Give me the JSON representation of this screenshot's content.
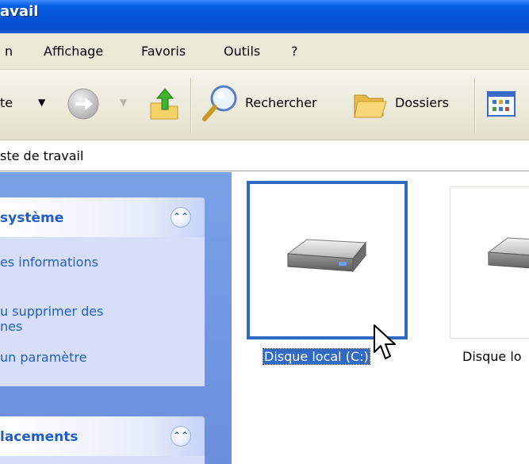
{
  "window": {
    "title": "avail"
  },
  "menu": {
    "items": [
      "n",
      "Affichage",
      "Favoris",
      "Outils",
      "?"
    ]
  },
  "toolbar": {
    "back_label": "te",
    "search_label": "Rechercher",
    "folders_label": "Dossiers"
  },
  "address": {
    "value": "ste de travail"
  },
  "sidebar": {
    "system_group": {
      "title": "système",
      "tasks": [
        "es informations",
        "u supprimer des",
        "nes",
        "un paramètre"
      ]
    },
    "places_group": {
      "title": "lacements"
    }
  },
  "drives": [
    {
      "label": "Disque local (C:)",
      "selected": true,
      "icon": "hard-drive-icon"
    },
    {
      "label": "Disque lo",
      "selected": false,
      "icon": "hard-drive-icon"
    }
  ],
  "colors": {
    "titlebar": "#0552d6",
    "sidebar_bg": "#6b8fdc",
    "group_bg": "#d6dff7",
    "link": "#215dc6",
    "selection": "#316ac5"
  }
}
